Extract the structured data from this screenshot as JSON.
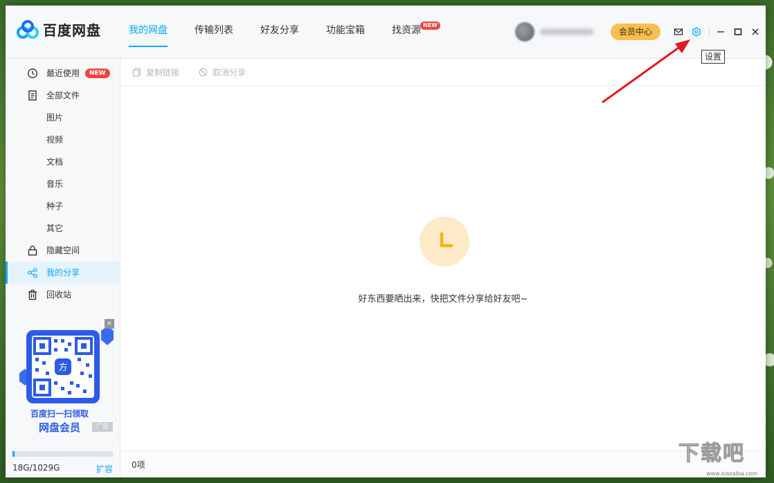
{
  "app": {
    "name": "百度网盘"
  },
  "nav": {
    "items": [
      {
        "label": "我的网盘"
      },
      {
        "label": "传输列表"
      },
      {
        "label": "好友分享"
      },
      {
        "label": "功能宝箱"
      },
      {
        "label": "找资源",
        "badge": "NEW"
      }
    ]
  },
  "header": {
    "vip_label": "会员中心",
    "settings_tooltip": "设置"
  },
  "sidebar": {
    "items": [
      {
        "label": "最近使用",
        "badge": "NEW"
      },
      {
        "label": "全部文件"
      },
      {
        "label": "图片"
      },
      {
        "label": "视频"
      },
      {
        "label": "文档"
      },
      {
        "label": "音乐"
      },
      {
        "label": "种子"
      },
      {
        "label": "其它"
      },
      {
        "label": "隐藏空间"
      },
      {
        "label": "我的分享"
      },
      {
        "label": "回收站"
      }
    ],
    "promo": {
      "line1": "百度扫一扫领取",
      "line2": "网盘会员",
      "ad": "广告",
      "qr_center": "方"
    },
    "storage": {
      "text": "18G/1029G",
      "used_fraction": 0.0175,
      "expand_label": "扩容"
    }
  },
  "toolbar": {
    "copy_link": "复制链接",
    "cancel_share": "取消分享"
  },
  "main": {
    "empty_message": "好东西要晒出来，快把文件分享给好友吧~"
  },
  "status": {
    "count": "0项"
  },
  "watermark": {
    "text": "下载吧",
    "sub": "www.xiazaiba.com"
  },
  "colors": {
    "accent": "#06a7ff",
    "badge": "#f0463e",
    "vip": "#f5c052",
    "arrow": "#e0191e",
    "promo_blue": "#2c5be6"
  },
  "icons": {
    "settings": "gear-icon",
    "mail": "mail-icon",
    "recent": "clock-icon",
    "files": "document-icon",
    "hidden": "lock-icon",
    "share": "share-icon",
    "trash": "trash-icon"
  }
}
